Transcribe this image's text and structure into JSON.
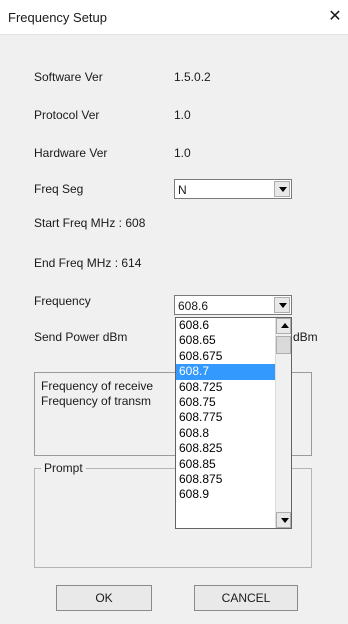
{
  "window": {
    "title": "Frequency Setup",
    "close_glyph": "✕"
  },
  "info": {
    "software_label": "Software Ver",
    "software_value": "1.5.0.2",
    "protocol_label": "Protocol Ver",
    "protocol_value": "1.0",
    "hardware_label": "Hardware Ver",
    "hardware_value": "1.0"
  },
  "freq_seg": {
    "label": "Freq Seg",
    "value": "N"
  },
  "start_freq": "Start Freq MHz : 608",
  "end_freq": "End Freq MHz : 614",
  "frequency": {
    "label": "Frequency",
    "value": "608.6"
  },
  "send_power": {
    "label": "Send Power dBm",
    "unit": "dBm"
  },
  "status_box": {
    "line1": "Frequency of receive",
    "line2": "Frequency of transm"
  },
  "prompt": {
    "legend": "Prompt"
  },
  "buttons": {
    "ok": "OK",
    "cancel": "CANCEL"
  },
  "dropdown": {
    "selected": "608.7",
    "items": [
      "608.6",
      "608.65",
      "608.675",
      "608.7",
      "608.725",
      "608.75",
      "608.775",
      "608.8",
      "608.825",
      "608.85",
      "608.875",
      "608.9"
    ]
  },
  "colors": {
    "selection": "#3399ff"
  },
  "icons": {
    "combo_arrow": "chevron-down-icon",
    "scroll_up": "scroll-up-icon",
    "scroll_down": "scroll-down-icon"
  }
}
